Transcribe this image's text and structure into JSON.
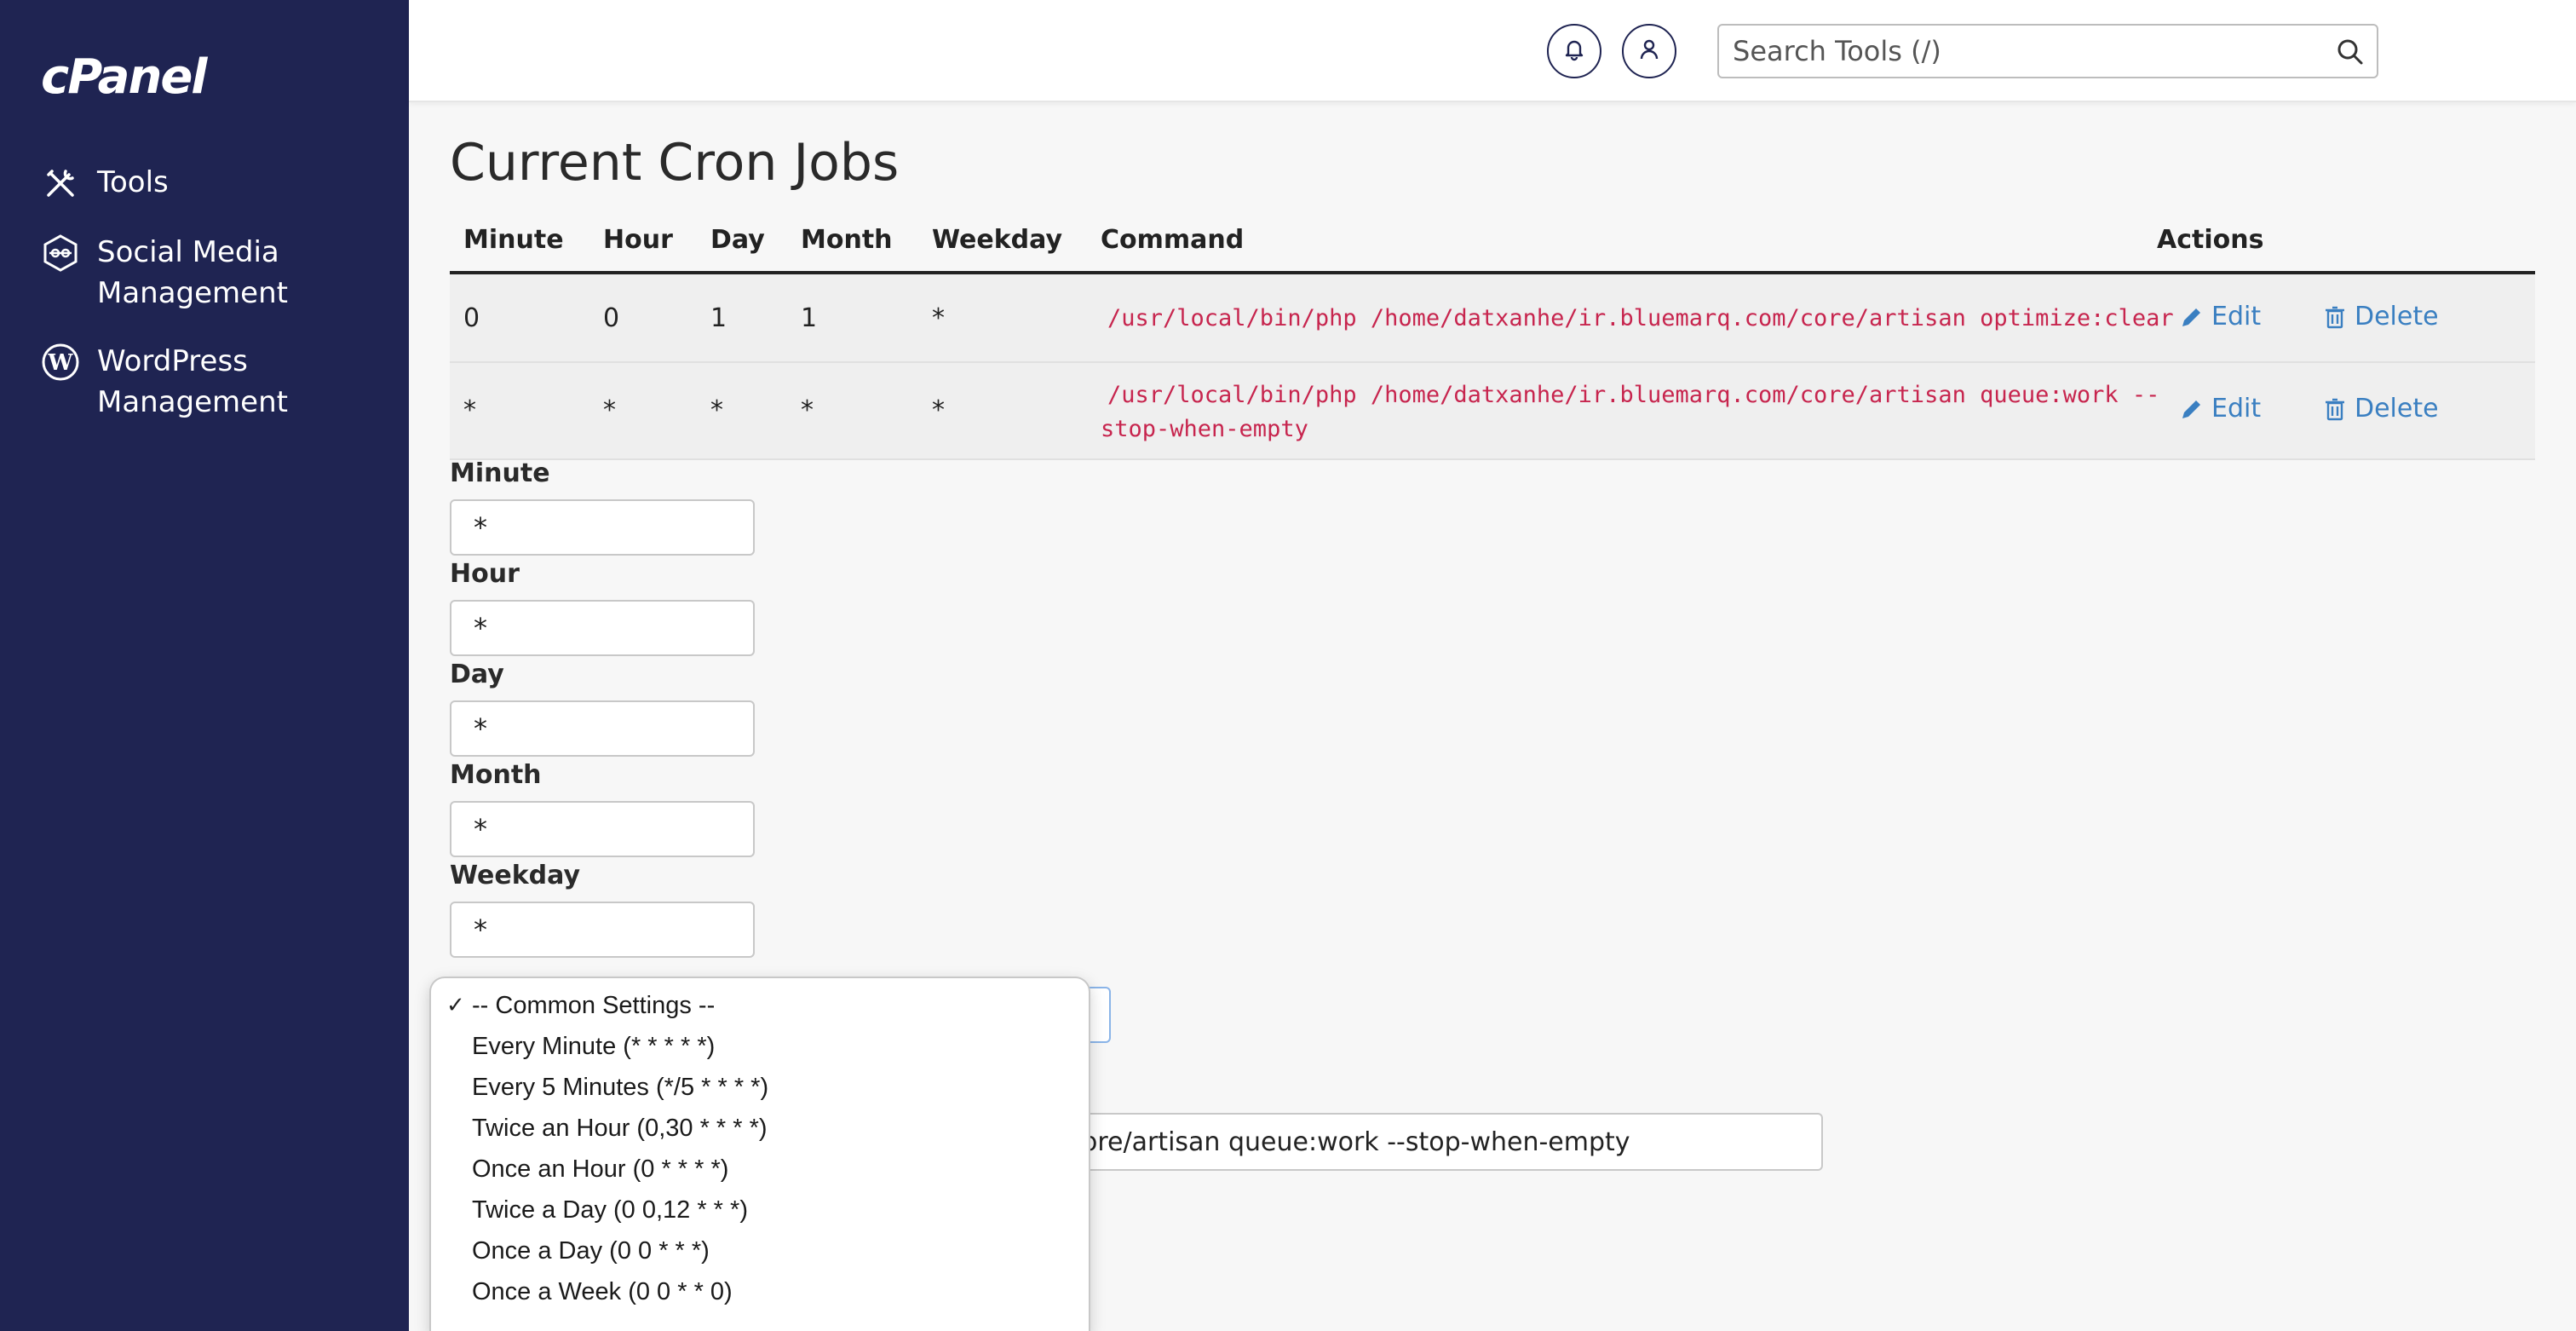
{
  "sidebar": {
    "logo": "cPanel",
    "items": [
      {
        "label": "Tools",
        "icon": "tools-icon"
      },
      {
        "label": "Social Media Management",
        "icon": "social-media-icon"
      },
      {
        "label": "WordPress Management",
        "icon": "wordpress-icon"
      }
    ]
  },
  "header": {
    "search_placeholder": "Search Tools (/)",
    "notifications_icon": "bell-icon",
    "user_icon": "user-icon"
  },
  "main": {
    "title": "Current Cron Jobs",
    "table": {
      "headers": [
        "Minute",
        "Hour",
        "Day",
        "Month",
        "Weekday",
        "Command",
        "Actions"
      ],
      "rows": [
        {
          "minute": "0",
          "hour": "0",
          "day": "1",
          "month": "1",
          "weekday": "*",
          "command": "/usr/local/bin/php /home/datxanhe/ir.bluemarq.com/core/artisan optimize:clear",
          "edit": "Edit",
          "delete": "Delete"
        },
        {
          "minute": "*",
          "hour": "*",
          "day": "*",
          "month": "*",
          "weekday": "*",
          "command_line1": "/usr/local/bin/php /home/datxanhe/ir.bluemarq.com/core/artisan queue:work --",
          "command_line2": "stop-when-empty",
          "edit": "Edit",
          "delete": "Delete"
        }
      ]
    },
    "form": {
      "minute_label": "Minute",
      "minute_value": "*",
      "hour_label": "Hour",
      "hour_value": "*",
      "day_label": "Day",
      "day_value": "*",
      "month_label": "Month",
      "month_value": "*",
      "weekday_label": "Weekday",
      "weekday_value": "*",
      "command_value": "ore/artisan queue:work --stop-when-empty"
    },
    "common_settings": {
      "selected": "-- Common Settings --",
      "options": [
        "-- Common Settings --",
        "Every Minute (* * * * *)",
        "Every 5 Minutes (*/5 * * * *)",
        "Twice an Hour (0,30 * * * *)",
        "Once an Hour (0 * * * *)",
        "Twice a Day (0 0,12 * * *)",
        "Once a Day (0 0 * * *)",
        "Once a Week (0 0 * * 0)"
      ]
    }
  },
  "colors": {
    "sidebar_bg": "#1f2452",
    "link": "#3a7fc1",
    "code": "#c7254e"
  }
}
